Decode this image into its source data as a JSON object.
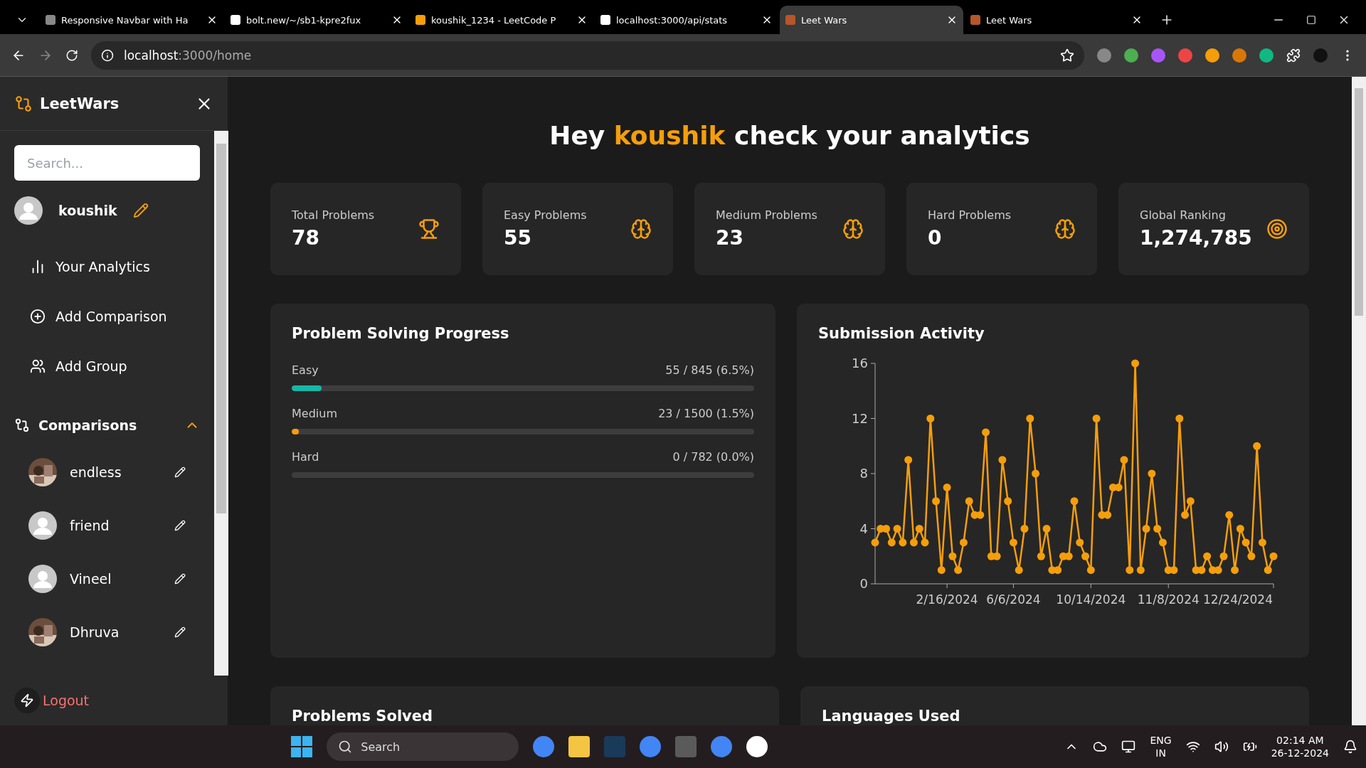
{
  "browser": {
    "tabs": [
      {
        "title": "Responsive Navbar with Ha",
        "selected": false
      },
      {
        "title": "bolt.new/~/sb1-kpre2fux",
        "selected": false
      },
      {
        "title": "koushik_1234 - LeetCode P",
        "selected": false
      },
      {
        "title": "localhost:3000/api/stats",
        "selected": false
      },
      {
        "title": "Leet Wars",
        "selected": true
      },
      {
        "title": "Leet Wars",
        "selected": false
      }
    ],
    "address": {
      "host": "localhost",
      "rest": ":3000/home"
    }
  },
  "sidebar": {
    "brand": "LeetWars",
    "search": {
      "placeholder": "Search..."
    },
    "user": "koushik",
    "nav": [
      {
        "label": "Your Analytics",
        "kind": "chart"
      },
      {
        "label": "Add Comparison",
        "kind": "plus"
      },
      {
        "label": "Add Group",
        "kind": "users"
      }
    ],
    "comparisons": {
      "title": "Comparisons",
      "expanded": true,
      "items": [
        {
          "name": "endless",
          "kind": "picture"
        },
        {
          "name": "friend",
          "kind": "default"
        },
        {
          "name": "Vineel",
          "kind": "default"
        },
        {
          "name": "Dhruva",
          "kind": "picture"
        }
      ]
    },
    "logout": "Logout"
  },
  "main": {
    "greeting": {
      "before": "Hey",
      "name": "koushik",
      "after": "check your analytics"
    },
    "stats": [
      {
        "label": "Total Problems",
        "value": "78",
        "kind": "trophy"
      },
      {
        "label": "Easy Problems",
        "value": "55",
        "kind": "brain"
      },
      {
        "label": "Medium Problems",
        "value": "23",
        "kind": "brain"
      },
      {
        "label": "Hard Problems",
        "value": "0",
        "kind": "brain"
      },
      {
        "label": "Global Ranking",
        "value": "1,274,785",
        "kind": "target"
      }
    ],
    "progress": {
      "title": "Problem Solving Progress",
      "rows": [
        {
          "label": "Easy",
          "reading": "55 / 845 (6.5%)",
          "level": 0.065,
          "color": "#14b8a6"
        },
        {
          "label": "Medium",
          "reading": "23 / 1500 (1.5%)",
          "level": 0.015,
          "color": "#f59e0b"
        },
        {
          "label": "Hard",
          "reading": "0 / 782 (0.0%)",
          "level": 0
        }
      ]
    },
    "activity": {
      "title": "Submission Activity",
      "x_labels": [
        "2/16/2024",
        "6/6/2024",
        "10/14/2024",
        "11/8/2024",
        "12/24/2024"
      ],
      "chart_data": {
        "type": "line",
        "ylim": [
          0,
          16
        ],
        "yticks": [
          0,
          4,
          8,
          12,
          16
        ],
        "series": [
          {
            "color": "#f59e0b",
            "marker": "circle",
            "values": [
              3,
              4,
              4,
              3,
              4,
              3,
              9,
              3,
              4,
              3,
              12,
              6,
              1,
              7,
              2,
              1,
              3,
              6,
              5,
              5,
              11,
              2,
              2,
              9,
              6,
              3,
              1,
              4,
              12,
              8,
              2,
              4,
              1,
              1,
              2,
              2,
              6,
              3,
              2,
              1,
              12,
              5,
              5,
              7,
              7,
              9,
              1,
              16,
              1,
              4,
              8,
              4,
              3,
              1,
              1,
              12,
              5,
              6,
              1,
              1,
              2,
              1,
              1,
              2,
              5,
              1,
              4,
              3,
              2,
              10,
              3,
              1,
              2
            ]
          }
        ]
      }
    },
    "lower": [
      "Problems Solved",
      "Languages Used"
    ]
  },
  "taskbar": {
    "search": "Search",
    "lang": "ENG",
    "region": "IN",
    "time": "02:14 AM",
    "date": "26-12-2024"
  }
}
